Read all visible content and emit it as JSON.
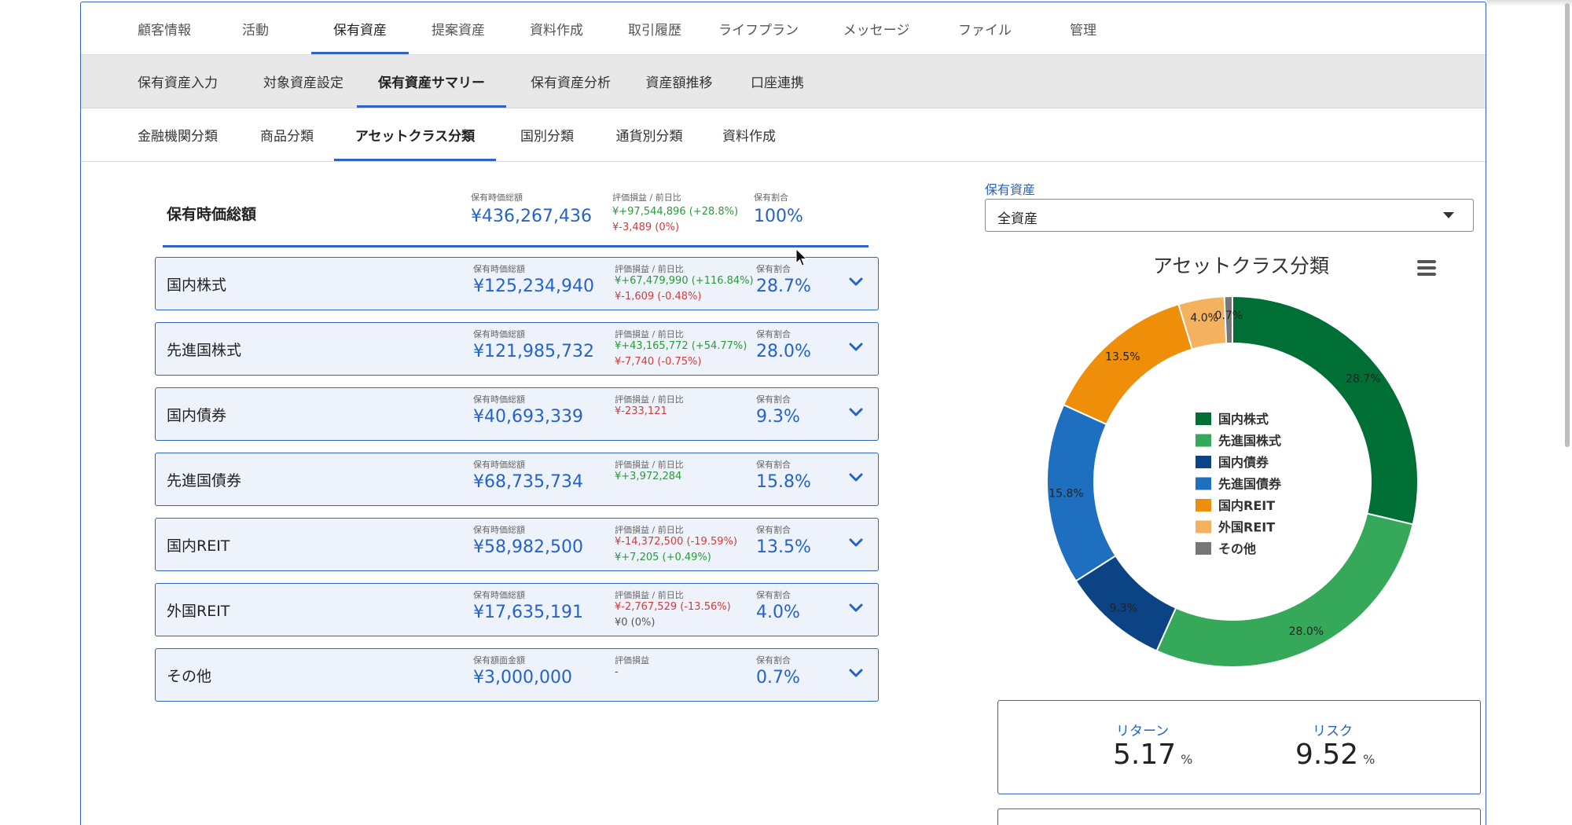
{
  "nav": {
    "main_tabs": [
      "顧客情報",
      "活動",
      "保有資産",
      "提案資産",
      "資料作成",
      "取引履歴",
      "ライフプラン",
      "メッセージ",
      "ファイル",
      "管理"
    ],
    "sub_tabs": [
      "保有資産入力",
      "対象資産設定",
      "保有資産サマリー",
      "保有資産分析",
      "資産額推移",
      "口座連携"
    ],
    "class_tabs": [
      "金融機関分類",
      "商品分類",
      "アセットクラス分類",
      "国別分類",
      "通貨別分類",
      "資料作成"
    ],
    "active_main": "保有資産",
    "active_sub": "保有資産サマリー",
    "active_class": "アセットクラス分類"
  },
  "summary": {
    "title": "保有時価総額",
    "value_label": "保有時価総額",
    "value": "¥436,267,436",
    "pnl_label": "評価損益 / 前日比",
    "pnl": "¥+97,544,896 (+28.8%)",
    "day_change": "¥-3,489 (0%)",
    "share_label": "保有割合",
    "share": "100%"
  },
  "assets": [
    {
      "name": "国内株式",
      "value_label": "保有時価総額",
      "value": "¥125,234,940",
      "pnl_label": "評価損益 / 前日比",
      "pnl": "¥+67,479,990 (+116.84%)",
      "pnl_color": "green",
      "day_change": "¥-1,609 (-0.48%)",
      "day_color": "red",
      "share_label": "保有割合",
      "share": "28.7%"
    },
    {
      "name": "先進国株式",
      "value_label": "保有時価総額",
      "value": "¥121,985,732",
      "pnl_label": "評価損益 / 前日比",
      "pnl": "¥+43,165,772 (+54.77%)",
      "pnl_color": "green",
      "day_change": "¥-7,740 (-0.75%)",
      "day_color": "red",
      "share_label": "保有割合",
      "share": "28.0%"
    },
    {
      "name": "国内債券",
      "value_label": "保有時価総額",
      "value": "¥40,693,339",
      "pnl_label": "評価損益 / 前日比",
      "pnl": "¥-233,121",
      "pnl_color": "red",
      "day_change": "",
      "day_color": "red",
      "share_label": "保有割合",
      "share": "9.3%"
    },
    {
      "name": "先進国債券",
      "value_label": "保有時価総額",
      "value": "¥68,735,734",
      "pnl_label": "評価損益 / 前日比",
      "pnl": "¥+3,972,284",
      "pnl_color": "green",
      "day_change": "",
      "day_color": "green",
      "share_label": "保有割合",
      "share": "15.8%"
    },
    {
      "name": "国内REIT",
      "value_label": "保有時価総額",
      "value": "¥58,982,500",
      "pnl_label": "評価損益 / 前日比",
      "pnl": "¥-14,372,500 (-19.59%)",
      "pnl_color": "red",
      "day_change": "¥+7,205 (+0.49%)",
      "day_color": "green",
      "share_label": "保有割合",
      "share": "13.5%"
    },
    {
      "name": "外国REIT",
      "value_label": "保有時価総額",
      "value": "¥17,635,191",
      "pnl_label": "評価損益 / 前日比",
      "pnl": "¥-2,767,529 (-13.56%)",
      "pnl_color": "red",
      "day_change": "¥0 (0%)",
      "day_color": "gray",
      "share_label": "保有割合",
      "share": "4.0%"
    },
    {
      "name": "その他",
      "value_label": "保有額面金額",
      "value": "¥3,000,000",
      "pnl_label": "評価損益",
      "pnl": "-",
      "pnl_color": "gray",
      "day_change": "",
      "day_color": "gray",
      "share_label": "保有割合",
      "share": "0.7%"
    }
  ],
  "holding_filter": {
    "label": "保有資産",
    "selected": "全資産"
  },
  "chart_data": {
    "type": "pie",
    "title": "アセットクラス分類",
    "categories": [
      "国内株式",
      "先進国株式",
      "国内債券",
      "先進国債券",
      "国内REIT",
      "外国REIT",
      "その他"
    ],
    "values": [
      28.7,
      28.0,
      9.3,
      15.8,
      13.5,
      4.0,
      0.7
    ],
    "labels": [
      "28.7%",
      "28.0%",
      "9.3%",
      "15.8%",
      "13.5%",
      "4.0%",
      "0.7%"
    ],
    "colors": [
      "#006f35",
      "#36a85a",
      "#0c4384",
      "#1f6fc0",
      "#ee8e09",
      "#f4b25f",
      "#777777"
    ],
    "legend": "center",
    "hole": "donut"
  },
  "metrics": {
    "return_label": "リターン",
    "return_value": "5.17",
    "return_unit": "%",
    "risk_label": "リスク",
    "risk_value": "9.52",
    "risk_unit": "%"
  }
}
